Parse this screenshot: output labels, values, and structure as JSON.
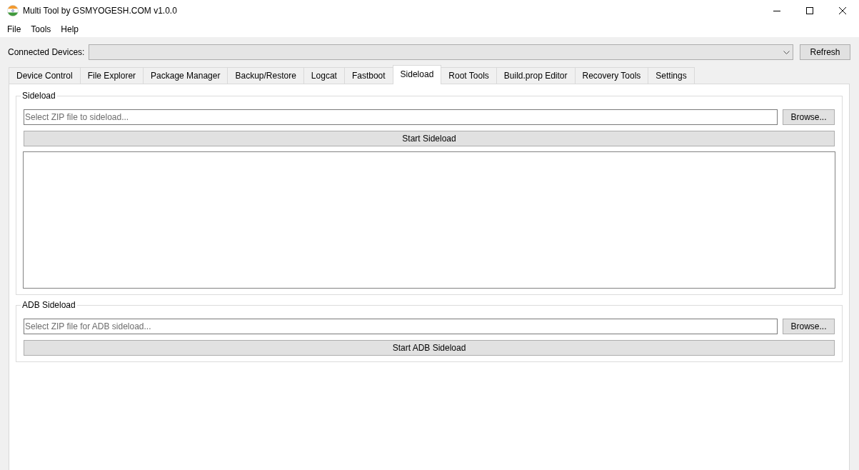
{
  "window": {
    "title": "Multi Tool by GSMYOGESH.COM v1.0.0"
  },
  "menu": [
    "File",
    "Tools",
    "Help"
  ],
  "device_bar": {
    "label": "Connected Devices:",
    "refresh_button": "Refresh"
  },
  "tabs": [
    {
      "label": "Device Control",
      "selected": false
    },
    {
      "label": "File Explorer",
      "selected": false
    },
    {
      "label": "Package Manager",
      "selected": false
    },
    {
      "label": "Backup/Restore",
      "selected": false
    },
    {
      "label": "Logcat",
      "selected": false
    },
    {
      "label": "Fastboot",
      "selected": false
    },
    {
      "label": "Sideload",
      "selected": true
    },
    {
      "label": "Root Tools",
      "selected": false
    },
    {
      "label": "Build.prop Editor",
      "selected": false
    },
    {
      "label": "Recovery Tools",
      "selected": false
    },
    {
      "label": "Settings",
      "selected": false
    }
  ],
  "groups": [
    {
      "title": "Sideload",
      "file_field": {
        "placeholder": "Select ZIP file to sideload..."
      },
      "browse_button": "Browse...",
      "start_button": "Start Sideload",
      "output_box": true
    },
    {
      "title": "ADB Sideload",
      "file_field": {
        "placeholder": "Select ZIP file for ADB sideload..."
      },
      "browse_button": "Browse...",
      "start_button": "Start ADB Sideload",
      "output_box": false
    }
  ]
}
